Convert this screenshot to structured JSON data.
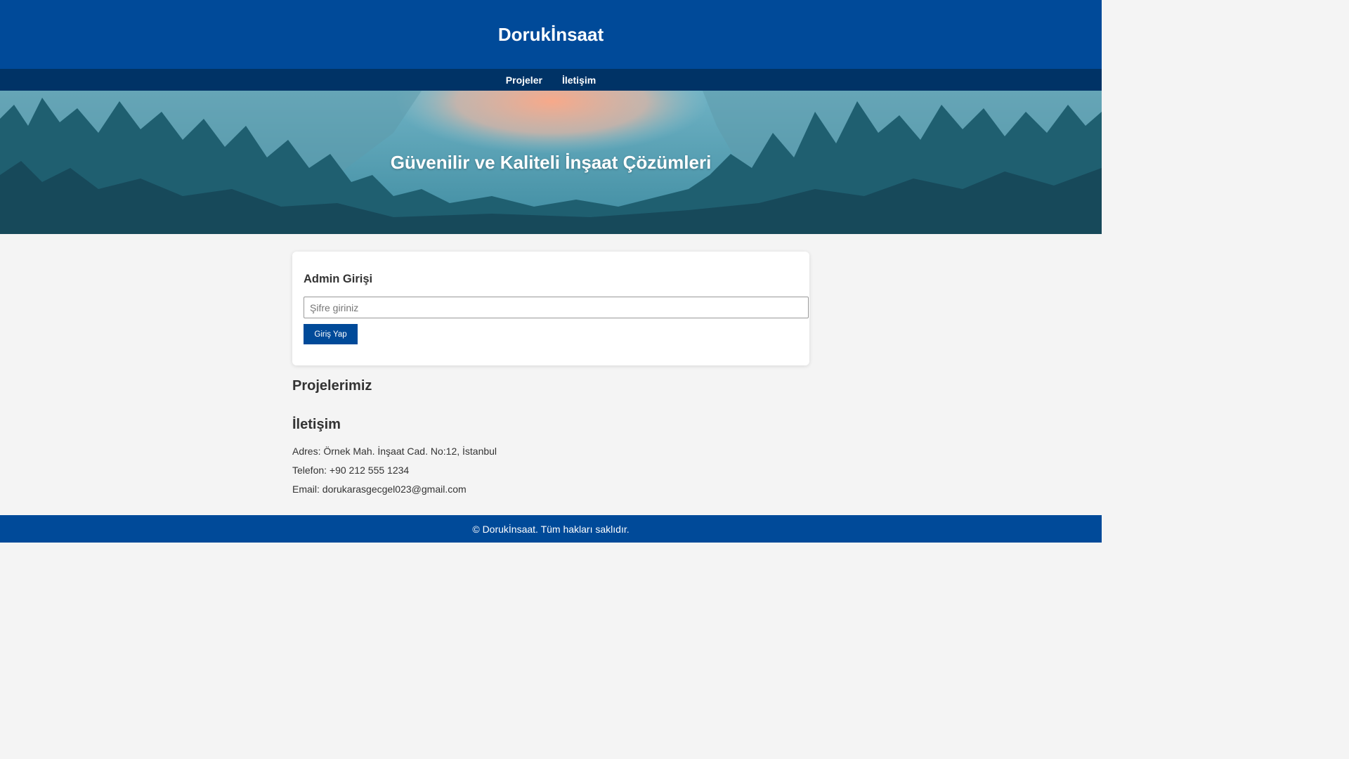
{
  "header": {
    "title": "Dorukİnsaat"
  },
  "nav": {
    "items": [
      {
        "label": "Projeler"
      },
      {
        "label": "İletişim"
      }
    ]
  },
  "hero": {
    "title": "Güvenilir ve Kaliteli İnşaat Çözümleri"
  },
  "admin_login": {
    "title": "Admin Girişi",
    "password_placeholder": "Şifre giriniz",
    "password_value": "",
    "submit_label": "Giriş Yap"
  },
  "projects": {
    "heading": "Projelerimiz"
  },
  "contact": {
    "heading": "İletişim",
    "address": "Adres: Örnek Mah. İnşaat Cad. No:12, İstanbul",
    "phone": "Telefon: +90 212 555 1234",
    "email": "Email: dorukarasgecgel023@gmail.com"
  },
  "footer": {
    "text": "© Dorukİnsaat. Tüm hakları saklıdır."
  },
  "colors": {
    "header_blue": "#004a99",
    "nav_navy": "#003366",
    "page_background": "#f4f4f4",
    "text": "#333333"
  }
}
